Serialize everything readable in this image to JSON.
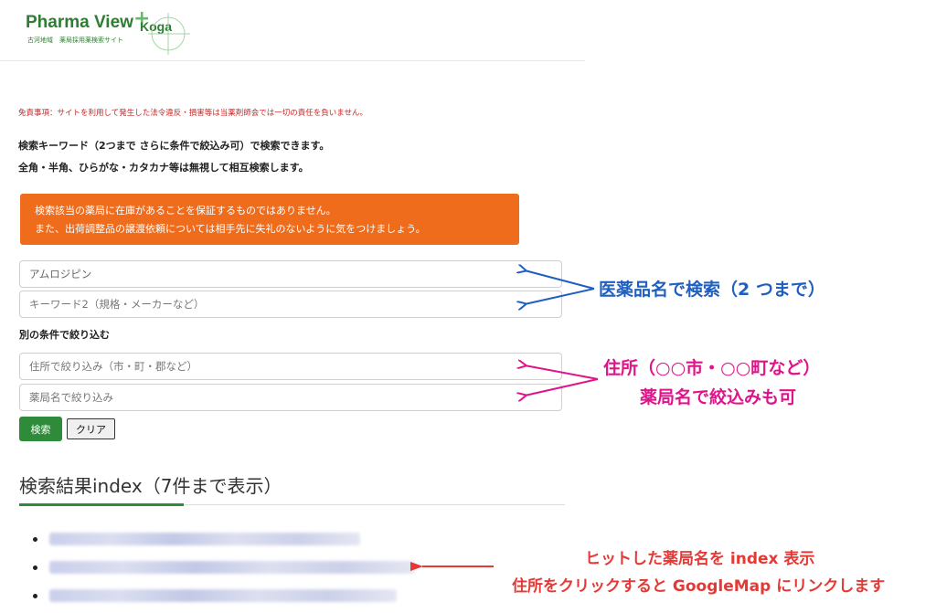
{
  "logo": {
    "brand": "Pharma View",
    "plus": "+",
    "koga": "Koga",
    "subtitle": "古河地域　薬局採用薬検索サイト"
  },
  "disclaimer": "免責事項：サイトを利用して発生した法令違反・損害等は当薬剤師会では一切の責任を負いません。",
  "intro": {
    "line1": "検索キーワード（2つまで さらに条件で絞込み可）で検索できます。",
    "line2": "全角・半角、ひらがな・カタカナ等は無視して相互検索します。"
  },
  "alert": {
    "line1": "検索該当の薬局に在庫があることを保証するものではありません。",
    "line2": "また、出荷調整品の譲渡依頼については相手先に失礼のないように気をつけましょう。"
  },
  "search": {
    "keyword1_value": "アムロジピン",
    "keyword2_placeholder": "キーワード2（規格・メーカーなど）",
    "filter_heading": "別の条件で絞り込む",
    "address_placeholder": "住所で絞り込み（市・町・郡など）",
    "pharmacy_placeholder": "薬局名で絞り込み",
    "search_button": "検索",
    "clear_button": "クリア"
  },
  "results": {
    "title": "検索結果index（7件まで表示）",
    "items": [
      "",
      "",
      ""
    ]
  },
  "annotations": {
    "drug_name": "医薬品名で検索（2 つまで）",
    "address_line1": "住所（○○市・○○町など）",
    "address_line2": "薬局名で絞込みも可",
    "results_line1": "ヒットした薬局名を index 表示",
    "results_line2": "住所をクリックすると GoogleMap にリンクします"
  },
  "colors": {
    "brand_green": "#2e7d32",
    "alert_orange": "#ef6c1d",
    "search_button": "#2e8b3a",
    "annotation_blue": "#1f5fbf",
    "annotation_pink": "#e0148a",
    "annotation_red": "#e53935",
    "disclaimer_red": "#c62828"
  }
}
